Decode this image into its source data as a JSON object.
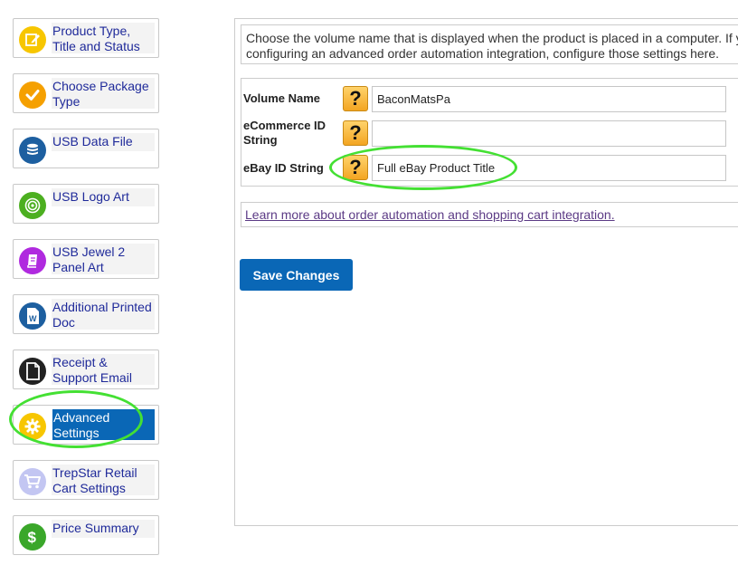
{
  "sidebar": {
    "items": [
      {
        "label": "Product Type, Title and Status",
        "icon": "edit-icon",
        "color": "#f7c600"
      },
      {
        "label": "Choose Package Type",
        "icon": "checkmark-icon",
        "color": "#f5a000"
      },
      {
        "label": "USB Data File",
        "icon": "database-icon",
        "color": "#1d5fa0"
      },
      {
        "label": "USB Logo Art",
        "icon": "target-icon",
        "color": "#4caf20"
      },
      {
        "label": "USB Jewel 2 Panel Art",
        "icon": "book-icon",
        "color": "#b02adf"
      },
      {
        "label": "Additional Printed Doc",
        "icon": "word-doc-icon",
        "color": "#1d5fa0"
      },
      {
        "label": "Receipt & Support Email",
        "icon": "document-icon",
        "color": "#222222"
      },
      {
        "label": "Advanced Settings",
        "icon": "gear-icon",
        "color": "#f7c600"
      },
      {
        "label": "TrepStar Retail Cart Settings",
        "icon": "cart-icon",
        "color": "#c3c6f2"
      },
      {
        "label": "Price Summary",
        "icon": "dollar-icon",
        "color": "#3aa72a"
      }
    ]
  },
  "main": {
    "description": "Choose the volume name that is displayed when the product is placed in a computer. If y",
    "description_line2": "configuring an advanced order automation integration, configure those settings here.",
    "fields": [
      {
        "label": "Volume Name",
        "value": "BaconMatsPa"
      },
      {
        "label": "eCommerce ID String",
        "value": ""
      },
      {
        "label": "eBay ID String",
        "value": "Full eBay Product Title"
      }
    ],
    "help_glyph": "?",
    "learn_more_link": "Learn more about order automation and shopping cart integration.",
    "save_label": "Save Changes"
  },
  "colors": {
    "accent": "#0a67b6",
    "highlight": "#44e033",
    "nav_text": "#1f2a9a"
  }
}
